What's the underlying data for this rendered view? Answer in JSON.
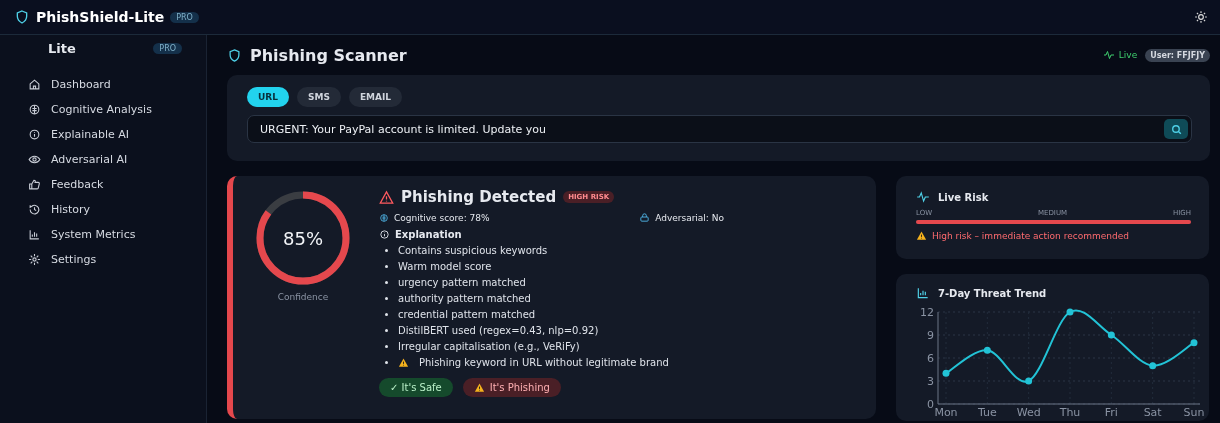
{
  "topbar": {
    "title": "PhishShield-Lite",
    "badge": "PRO"
  },
  "sidebar": {
    "brand": "Lite",
    "badge": "PRO",
    "items": [
      {
        "label": "Dashboard",
        "selected": false
      },
      {
        "label": "Cognitive Analysis",
        "selected": false
      },
      {
        "label": "Explainable AI",
        "selected": false
      },
      {
        "label": "Adversarial AI",
        "selected": false
      },
      {
        "label": "Feedback",
        "selected": false
      },
      {
        "label": "History",
        "selected": false
      },
      {
        "label": "System Metrics",
        "selected": false
      },
      {
        "label": "Settings",
        "selected": false
      }
    ]
  },
  "header": {
    "title": "Phishing Scanner",
    "status": "Live",
    "user": "User: FFJFJY"
  },
  "scanner": {
    "tabs": [
      {
        "label": "URL",
        "selected": true
      },
      {
        "label": "SMS",
        "selected": false
      },
      {
        "label": "EMAIL",
        "selected": false
      }
    ],
    "input": {
      "value": "URGENT: Your PayPal account is limited. Update you"
    }
  },
  "result": {
    "confidence": {
      "level": 0.85,
      "reading": "85%",
      "caption": "Confidence"
    },
    "title": "Phishing Detected",
    "badge": "HIGH RISK",
    "cognitive": "Cognitive score: 78%",
    "adversarial": "Adversarial: No",
    "explanation_title": "Explanation",
    "explanations": [
      {
        "text": "Contains suspicious keywords",
        "warning": false
      },
      {
        "text": "Warm model score",
        "warning": false
      },
      {
        "text": "urgency pattern matched",
        "warning": false
      },
      {
        "text": "authority pattern matched",
        "warning": false
      },
      {
        "text": "credential pattern matched",
        "warning": false
      },
      {
        "text": "DistilBERT used (regex=0.43, nlp=0.92)",
        "warning": false
      },
      {
        "text": "Irregular capitalisation (e.g., VeRiFy)",
        "warning": false
      },
      {
        "text": "Phishing keyword in URL without legitimate brand",
        "warning": true
      }
    ],
    "buttons": [
      {
        "label": "✓ It's Safe",
        "kind": "safe"
      },
      {
        "label": "It's Phishing",
        "kind": "phish"
      }
    ]
  },
  "live_risk": {
    "title": "Live Risk",
    "scale": [
      "LOW",
      "MEDIUM",
      "HIGH"
    ],
    "level": 1,
    "message": "High risk – immediate action recommended"
  },
  "trend": {
    "title": "7-Day Threat Trend",
    "chart_data": {
      "type": "line",
      "categories": [
        "Mon",
        "Tue",
        "Wed",
        "Thu",
        "Fri",
        "Sat",
        "Sun"
      ],
      "series": [
        {
          "color": "#22c3d6",
          "marker": true,
          "values": [
            4,
            7,
            3,
            12,
            9,
            5,
            8
          ]
        }
      ],
      "ylim": [
        0,
        12
      ],
      "yticks": [
        0,
        3,
        6,
        9,
        12
      ],
      "grid": true
    }
  }
}
